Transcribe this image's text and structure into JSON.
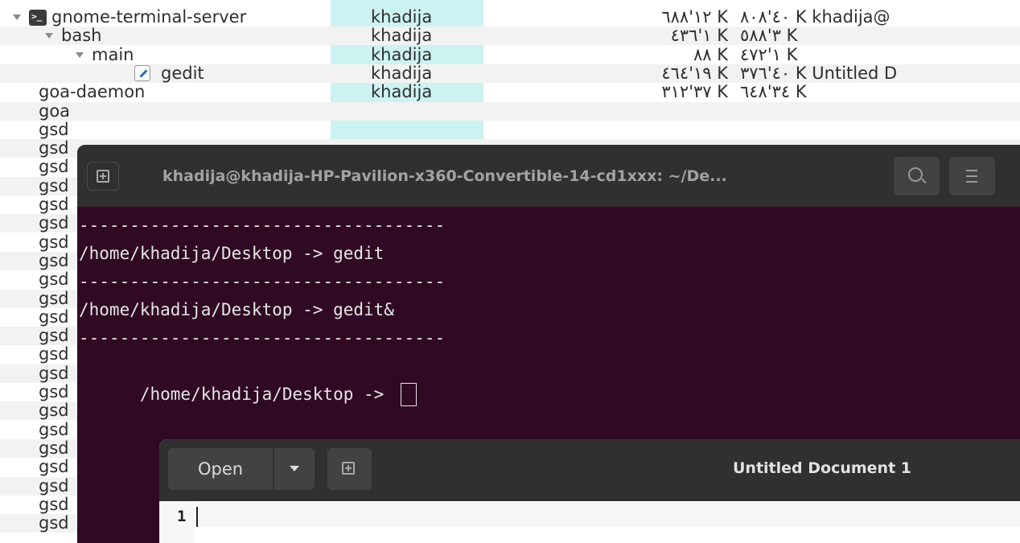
{
  "process_list": {
    "rows": [
      {
        "name": "gnome-terminal-server",
        "user": "khadija",
        "mem1": "١٢'٦٨٨ K",
        "mem2": "٤٠'٨٠٨ K khadija@",
        "expanded": true,
        "icon": "terminal-icon"
      },
      {
        "name": "bash",
        "user": "khadija",
        "mem1": "١'٤٣٦ K",
        "mem2": "٣'٥٨٨ K",
        "expanded": true,
        "icon": ""
      },
      {
        "name": "main",
        "user": "khadija",
        "mem1": "٨٨ K",
        "mem2": "١'٤٧٢ K",
        "expanded": true,
        "icon": ""
      },
      {
        "name": "gedit",
        "user": "khadija",
        "mem1": "١٩'٤٦٤ K",
        "mem2": "٤٠'٣٧٦ K Untitled D",
        "expanded": false,
        "icon": "gedit-icon"
      },
      {
        "name": "goa-daemon",
        "user": "khadija",
        "mem1": "٣٧'٣١٢ K",
        "mem2": "٣٤'٦٤٨ K",
        "expanded": false,
        "icon": ""
      },
      {
        "name": "goa",
        "user": "",
        "mem1": "",
        "mem2": "",
        "expanded": false,
        "icon": ""
      },
      {
        "name": "gsd",
        "user": "",
        "mem1": "",
        "mem2": "",
        "expanded": false,
        "icon": ""
      },
      {
        "name": "gsd",
        "user": "",
        "mem1": "",
        "mem2": "",
        "expanded": false,
        "icon": ""
      },
      {
        "name": "gsd",
        "user": "",
        "mem1": "",
        "mem2": "",
        "expanded": false,
        "icon": ""
      },
      {
        "name": "gsd",
        "user": "",
        "mem1": "",
        "mem2": "",
        "expanded": false,
        "icon": ""
      },
      {
        "name": "gsd",
        "user": "",
        "mem1": "",
        "mem2": "",
        "expanded": false,
        "icon": ""
      },
      {
        "name": "gsd",
        "user": "",
        "mem1": "",
        "mem2": "",
        "expanded": false,
        "icon": ""
      },
      {
        "name": "gsd",
        "user": "",
        "mem1": "",
        "mem2": "",
        "expanded": false,
        "icon": ""
      },
      {
        "name": "gsd",
        "user": "",
        "mem1": "",
        "mem2": "",
        "expanded": false,
        "icon": ""
      },
      {
        "name": "gsd",
        "user": "",
        "mem1": "",
        "mem2": "",
        "expanded": false,
        "icon": ""
      },
      {
        "name": "gsd",
        "user": "",
        "mem1": "",
        "mem2": "",
        "expanded": false,
        "icon": ""
      },
      {
        "name": "gsd",
        "user": "",
        "mem1": "",
        "mem2": "",
        "expanded": false,
        "icon": ""
      },
      {
        "name": "gsd",
        "user": "",
        "mem1": "",
        "mem2": "",
        "expanded": false,
        "icon": ""
      },
      {
        "name": "gsd",
        "user": "",
        "mem1": "",
        "mem2": "",
        "expanded": false,
        "icon": ""
      },
      {
        "name": "gsd",
        "user": "",
        "mem1": "",
        "mem2": "",
        "expanded": false,
        "icon": ""
      },
      {
        "name": "gsd",
        "user": "",
        "mem1": "",
        "mem2": "",
        "expanded": false,
        "icon": ""
      },
      {
        "name": "gsd",
        "user": "",
        "mem1": "",
        "mem2": "",
        "expanded": false,
        "icon": ""
      },
      {
        "name": "gsd",
        "user": "",
        "mem1": "",
        "mem2": "",
        "expanded": false,
        "icon": ""
      },
      {
        "name": "gsd",
        "user": "",
        "mem1": "",
        "mem2": "",
        "expanded": false,
        "icon": ""
      },
      {
        "name": "gsd",
        "user": "",
        "mem1": "",
        "mem2": "",
        "expanded": false,
        "icon": ""
      },
      {
        "name": "gsd",
        "user": "",
        "mem1": "",
        "mem2": "",
        "expanded": false,
        "icon": ""
      },
      {
        "name": "gsd",
        "user": "",
        "mem1": "",
        "mem2": "",
        "expanded": false,
        "icon": ""
      },
      {
        "name": "gsd",
        "user": "",
        "mem1": "",
        "mem2": "",
        "expanded": false,
        "icon": ""
      }
    ]
  },
  "terminal": {
    "title": "khadija@khadija-HP-Pavilion-x360-Convertible-14-cd1xxx: ~/De...",
    "new_tab_icon": "new-tab-icon",
    "search_icon": "search-icon",
    "menu_icon": "hamburger-menu-icon",
    "lines": [
      "------------------------------------",
      "/home/khadija/Desktop -> gedit",
      "------------------------------------",
      "/home/khadija/Desktop -> gedit&",
      "------------------------------------"
    ],
    "prompt": "/home/khadija/Desktop -> "
  },
  "gedit": {
    "open_label": "Open",
    "title": "Untitled Document 1",
    "line_number": "1"
  },
  "colors": {
    "terminal_bg": "#300a24",
    "header_bg": "#303030",
    "user_column_highlight": "#cdf2f2"
  }
}
